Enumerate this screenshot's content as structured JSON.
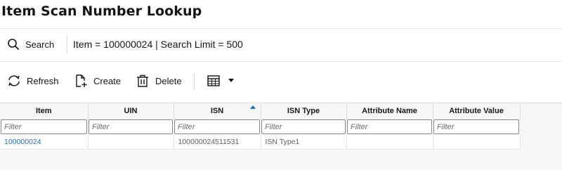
{
  "page": {
    "title": "Item Scan Number Lookup"
  },
  "search": {
    "button_label": "Search",
    "icon": "search-icon",
    "summary": "Item = 100000024 | Search Limit = 500"
  },
  "toolbar": {
    "refresh_label": "Refresh",
    "create_label": "Create",
    "delete_label": "Delete",
    "icons": [
      "refresh-icon",
      "create-icon",
      "delete-icon",
      "table-view-icon",
      "chevron-down-icon"
    ]
  },
  "grid": {
    "columns": [
      "Item",
      "UIN",
      "ISN",
      "ISN Type",
      "Attribute Name",
      "Attribute Value"
    ],
    "sorted_column": "ISN",
    "sort_direction": "ascending",
    "filter_placeholder": "Filter",
    "rows": [
      {
        "item": "100000024",
        "uin": "",
        "isn": "100000024511531",
        "isn_type": "ISN Type1",
        "attribute_name": "",
        "attribute_value": ""
      }
    ]
  },
  "colors": {
    "link": "#2f6aa9",
    "sort_indicator": "#1f6fb4",
    "text": "#161513",
    "grid_background": "#f7f7f7"
  }
}
